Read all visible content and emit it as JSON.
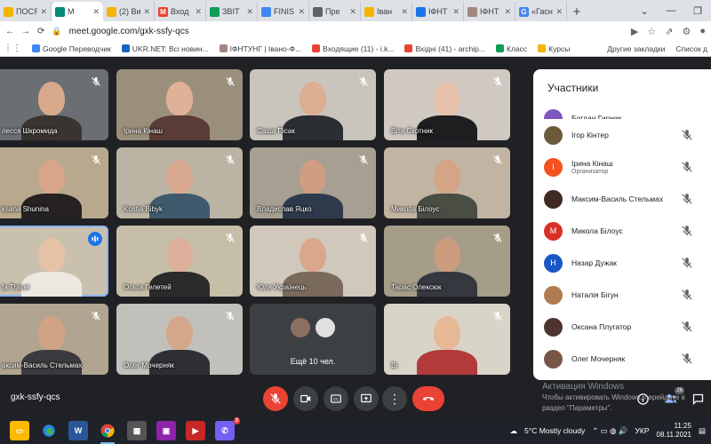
{
  "browser": {
    "tabs": [
      {
        "label": "ПОСЯ",
        "color": "#f4b400",
        "glyph": "",
        "active": false
      },
      {
        "label": "M",
        "color": "#00897b",
        "glyph": "",
        "active": true
      },
      {
        "label": "(2) Ви",
        "color": "#f4b400",
        "glyph": "",
        "active": false
      },
      {
        "label": "Вход",
        "color": "#ea4335",
        "glyph": "M",
        "active": false
      },
      {
        "label": "ЗВІТ",
        "color": "#0f9d58",
        "glyph": "",
        "active": false
      },
      {
        "label": "FINIS",
        "color": "#4285f4",
        "glyph": "",
        "active": false
      },
      {
        "label": "Пре",
        "color": "#5f6368",
        "glyph": "",
        "active": false
      },
      {
        "label": "Іван",
        "color": "#f4b400",
        "glyph": "",
        "active": false
      },
      {
        "label": "ІФНТ",
        "color": "#1a73e8",
        "glyph": "",
        "active": false
      },
      {
        "label": "ІФНТ",
        "color": "#a1887f",
        "glyph": "",
        "active": false
      },
      {
        "label": "«Гасн",
        "color": "#4285f4",
        "glyph": "G",
        "active": false
      }
    ],
    "new_tab": "+",
    "url": "meet.google.com/gxk-ssfy-qcs",
    "bookmarks": [
      {
        "label": "Google Переводчик",
        "color": "#4285f4"
      },
      {
        "label": "UKR.NET: Всі новин...",
        "color": "#1565c0"
      },
      {
        "label": "ІФНТУНГ | Івано-Ф...",
        "color": "#a1887f"
      },
      {
        "label": "Входящие (11) - i.k...",
        "color": "#ea4335"
      },
      {
        "label": "Вхідні (41) - archip...",
        "color": "#ea4335"
      },
      {
        "label": "Класс",
        "color": "#0f9d58"
      },
      {
        "label": "Курсы",
        "color": "#f4b400"
      }
    ],
    "bookmarks_right": [
      "Другие закладки",
      "Список д"
    ]
  },
  "meet": {
    "code": "gxk-ssfy-qcs",
    "tiles": [
      {
        "name": "лесся Шкромида",
        "speaking": false
      },
      {
        "name": "Ірина Кінаш",
        "speaking": false
      },
      {
        "name": "Саша Пісак",
        "speaking": false
      },
      {
        "name": "Віта Скотник",
        "speaking": false
      },
      {
        "name": "ksana Shunina",
        "speaking": false
      },
      {
        "name": "Kostia Bibyk",
        "speaking": false
      },
      {
        "name": "Владислав Яцко",
        "speaking": false
      },
      {
        "name": "Микола Білоус",
        "speaking": false
      },
      {
        "name": "fa Travel",
        "speaking": true
      },
      {
        "name": "Ольга Гелетей",
        "speaking": false
      },
      {
        "name": "Юля Українець",
        "speaking": false
      },
      {
        "name": "Тарас Олексюк",
        "speaking": false
      },
      {
        "name": "аксим-Василь Стельмах",
        "speaking": false
      },
      {
        "name": "Олег Мочерняк",
        "speaking": false
      },
      {
        "name": "Ещё 10 чел.",
        "speaking": false
      },
      {
        "name": "Ві",
        "speaking": false
      }
    ],
    "participants_panel": {
      "title": "Участники",
      "partial_first": "Богдан Гирник",
      "people": [
        {
          "name": "Ігор Кінтер",
          "role": "",
          "avatar_letter": "",
          "avatar_color": "#6d5a3d"
        },
        {
          "name": "Ірина Кінаш",
          "role": "Организатор",
          "avatar_letter": "І",
          "avatar_color": "#f4511e"
        },
        {
          "name": "Максим-Василь Стельмах",
          "role": "",
          "avatar_letter": "",
          "avatar_color": "#3e2a20"
        },
        {
          "name": "Микола Білоус",
          "role": "",
          "avatar_letter": "М",
          "avatar_color": "#d93025"
        },
        {
          "name": "Назар Дужак",
          "role": "",
          "avatar_letter": "Н",
          "avatar_color": "#1a56c7"
        },
        {
          "name": "Наталія Бігун",
          "role": "",
          "avatar_letter": "",
          "avatar_color": "#b07c4f"
        },
        {
          "name": "Оксана Плугатор",
          "role": "",
          "avatar_letter": "",
          "avatar_color": "#4e342e"
        },
        {
          "name": "Олег Мочерняк",
          "role": "",
          "avatar_letter": "",
          "avatar_color": "#795548"
        }
      ],
      "count_badge": "26"
    },
    "watermark": {
      "line1": "Активация Windows",
      "line2": "Чтобы активировать Windows, перейдите в",
      "line3": "раздел \"Параметры\"."
    }
  },
  "taskbar": {
    "weather": "5°C  Mostly cloudy",
    "lang": "УКР",
    "time": "11:25",
    "date": "08.11.2021",
    "notification_count": "3"
  },
  "colors": {
    "meet_bg": "#202124",
    "tile_bg": "#3c4043",
    "danger": "#ea4335",
    "speaking": "#1a73e8"
  }
}
